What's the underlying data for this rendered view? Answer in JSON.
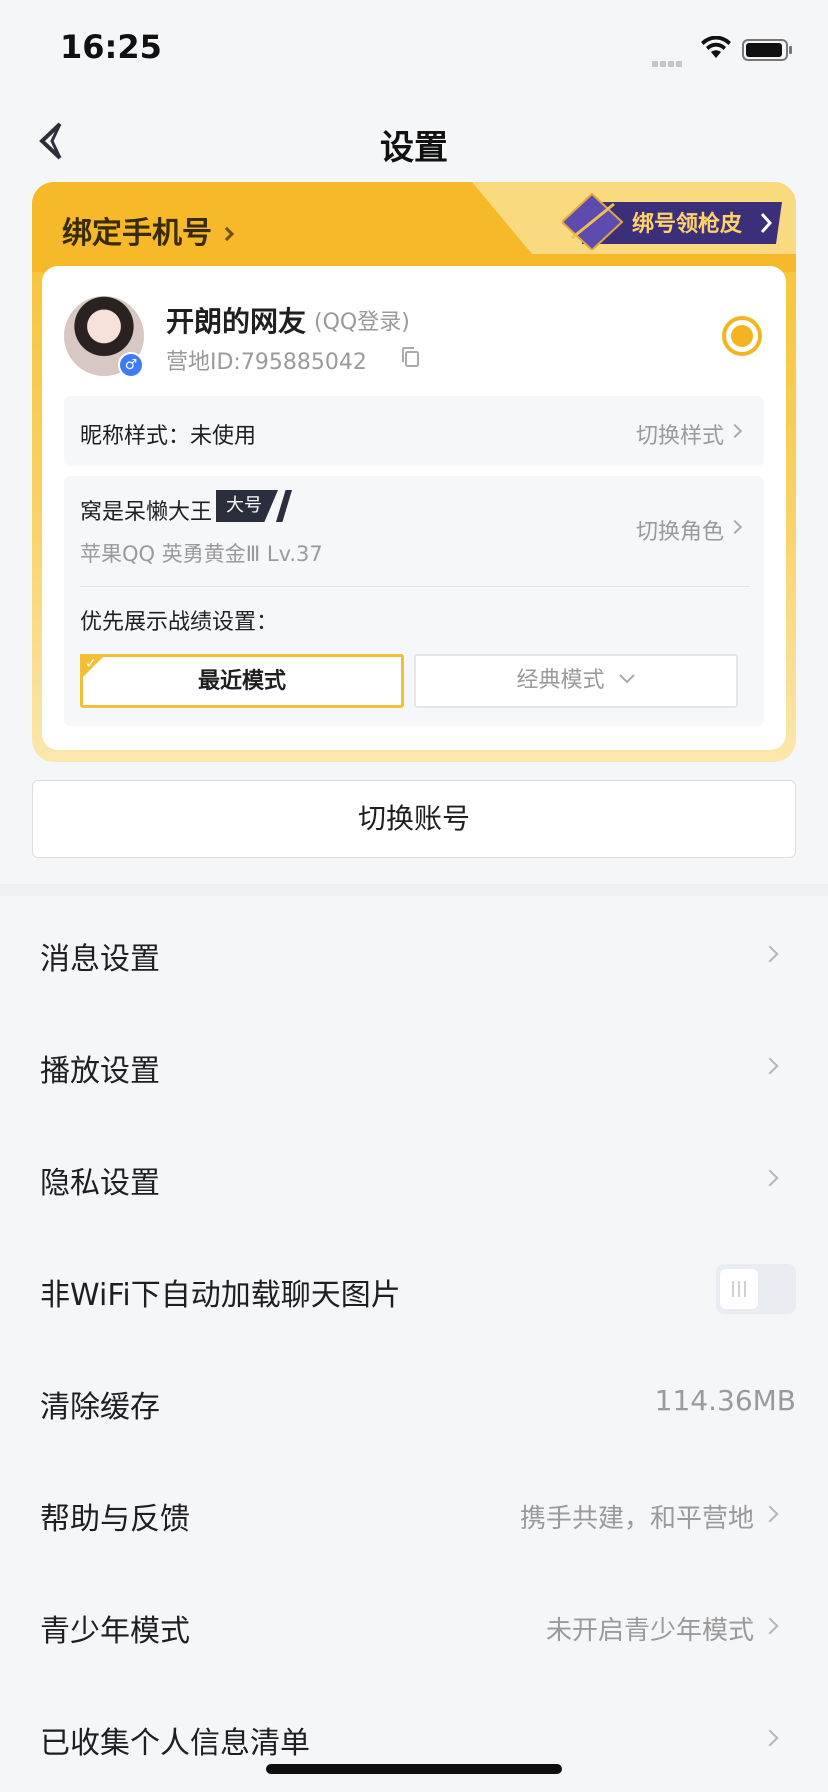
{
  "status_bar": {
    "time": "16:25"
  },
  "nav": {
    "title": "设置"
  },
  "bind_card": {
    "bind_phone_label": "绑定手机号",
    "promo_label": "绑号领枪皮"
  },
  "account": {
    "name": "开朗的网友",
    "login_type": "(QQ登录)",
    "id_text": "营地ID:795885042",
    "gender": "♂"
  },
  "nickname": {
    "label": "昵称样式：未使用",
    "switch_label": "切换样式"
  },
  "role": {
    "name": "窝是呆懒大王",
    "tag": "大号",
    "meta": "苹果QQ  英勇黄金Ⅲ  Lv.37",
    "switch_label": "切换角色",
    "pref_label": "优先展示战绩设置：",
    "mode_recent": "最近模式",
    "mode_classic": "经典模式"
  },
  "switch_account_label": "切换账号",
  "menu": [
    {
      "label": "消息设置",
      "value": ""
    },
    {
      "label": "播放设置",
      "value": ""
    },
    {
      "label": "隐私设置",
      "value": ""
    },
    {
      "label": "非WiFi下自动加载聊天图片",
      "value": ""
    },
    {
      "label": "清除缓存",
      "value": "114.36MB"
    },
    {
      "label": "帮助与反馈",
      "value": "携手共建，和平营地"
    },
    {
      "label": "青少年模式",
      "value": "未开启青少年模式"
    },
    {
      "label": "已收集个人信息清单",
      "value": ""
    }
  ],
  "colors": {
    "accent_gold": "#f3b51f",
    "badge_blue": "#3e7bf4",
    "tag_dark": "#2b2e3d"
  }
}
